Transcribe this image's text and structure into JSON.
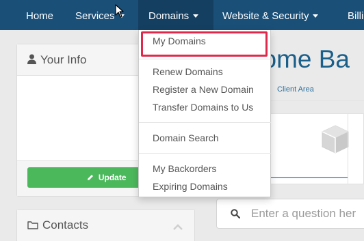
{
  "nav": {
    "home": "Home",
    "services": "Services",
    "domains": "Domains",
    "website_security": "Website & Security",
    "billing": "Billi"
  },
  "dropdown": {
    "my_domains": "My Domains",
    "renew": "Renew Domains",
    "register": "Register a New Domain",
    "transfer": "Transfer Domains to Us",
    "search": "Domain Search",
    "backorders": "My Backorders",
    "expiring": "Expiring Domains"
  },
  "your_info": {
    "title": "Your Info",
    "update_label": "Update"
  },
  "contacts": {
    "title": "Contacts"
  },
  "main": {
    "welcome": "come Ba",
    "breadcrumb": "Client Area",
    "search_placeholder": "Enter a question her"
  },
  "colors": {
    "nav_bg": "#1a4f78",
    "accent_blue": "#1a5f8a",
    "update_green": "#4cb85c",
    "highlight_red": "#e0284a"
  },
  "icons": [
    "user-icon",
    "folder-icon",
    "pencil-icon",
    "chevron-up-icon",
    "cube-icon",
    "search-icon",
    "cursor-arrow-icon"
  ]
}
